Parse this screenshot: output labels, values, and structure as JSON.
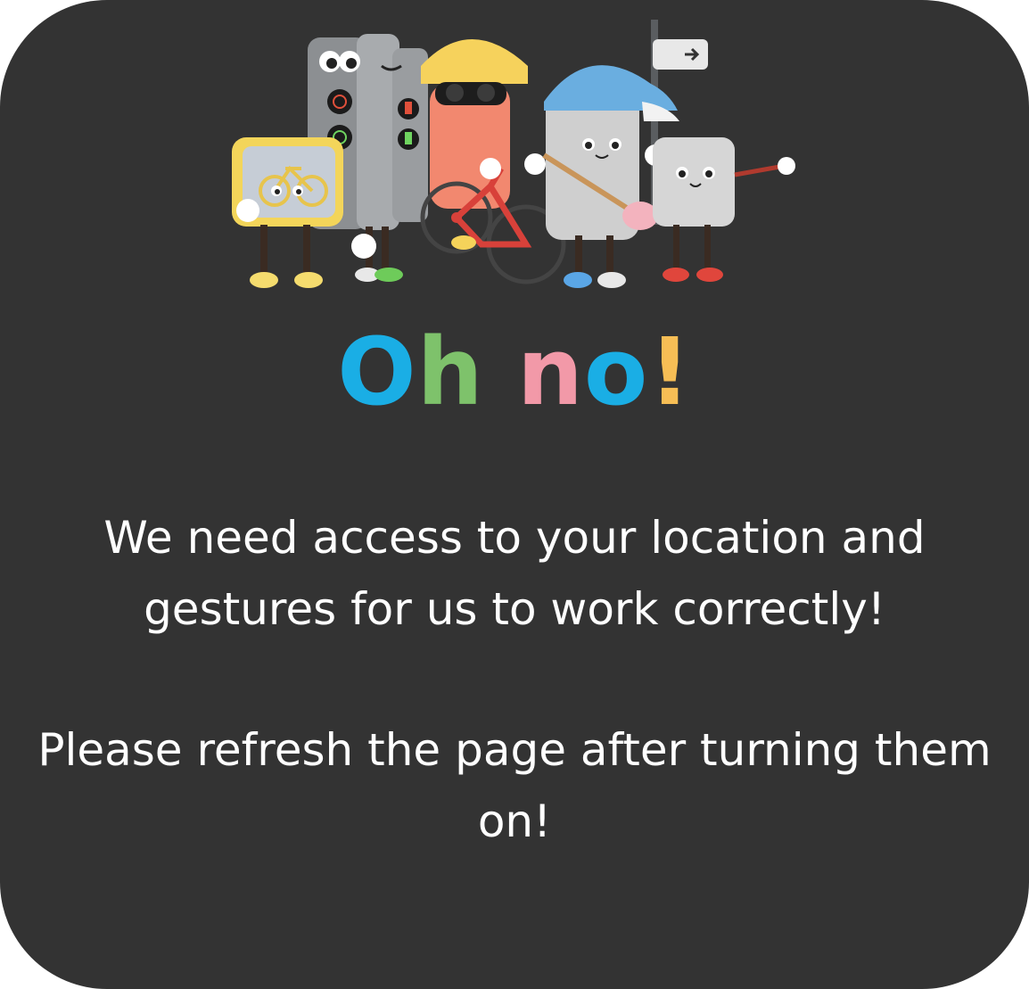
{
  "dialog": {
    "title_letters": [
      {
        "char": "O",
        "color": "#1aaee5"
      },
      {
        "char": "h",
        "color": "#7ec26b"
      },
      {
        "char": " ",
        "color": "#ffffff"
      },
      {
        "char": "n",
        "color": "#f299a8"
      },
      {
        "char": "o",
        "color": "#1aaee5"
      },
      {
        "char": "!",
        "color": "#f7be55"
      }
    ],
    "message_line_1": "We need access to your location and gestures for us to work correctly!",
    "message_line_2": "Please refresh the page after turning them on!"
  },
  "illustration": {
    "icon": "street-mascots-illustration",
    "characters": [
      "traffic-light-mascot",
      "bike-sign-mascot",
      "cyclist-mascot",
      "signpost-mascot",
      "box-mascot"
    ]
  }
}
